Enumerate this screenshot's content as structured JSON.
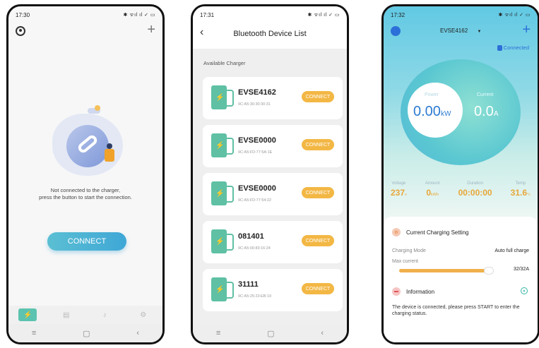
{
  "phone1": {
    "status_time": "17:30",
    "status_icons": "✱ ᯤıl ıl ✓ ▭",
    "message_line1": "Not connected to the charger,",
    "message_line2": "press the button to start the connection.",
    "connect_label": "CONNECT",
    "tabs": [
      {
        "icon": "lightning-icon",
        "glyph": "⚡"
      },
      {
        "icon": "document-icon",
        "glyph": "▤"
      },
      {
        "icon": "bell-icon",
        "glyph": "♪"
      },
      {
        "icon": "settings-icon",
        "glyph": "⚙"
      }
    ],
    "nav": [
      "≡",
      "▢",
      "‹"
    ]
  },
  "phone2": {
    "status_time": "17:31",
    "status_icons": "✱ ᯤıl ıl ✓ ▭",
    "back": "‹",
    "title": "Bluetooth Device List",
    "section_label": "Available Charger",
    "devices": [
      {
        "name": "EVSE4162",
        "mac": "9C:A5:30:30:30:31",
        "button": "CONNECT"
      },
      {
        "name": "EVSE0000",
        "mac": "9C:A5:FD:77:5A:1E",
        "button": "CONNECT"
      },
      {
        "name": "EVSE0000",
        "mac": "9C:A5:FD:77:54:22",
        "button": "CONNECT"
      },
      {
        "name": "081401",
        "mac": "9C:A5:00:83:16:24",
        "button": "CONNECT"
      },
      {
        "name": "31111",
        "mac": "9C:A5:25:23:EB:19",
        "button": "CONNECT"
      }
    ],
    "nav": [
      "≡",
      "▢",
      "‹"
    ]
  },
  "phone3": {
    "status_time": "17:32",
    "status_icons": "✱ ᯤıl ıl ✓ ▭",
    "device_name": "EVSE4162",
    "dropdown": "▼",
    "connected_label": "Connected",
    "power_label": "Power",
    "power_value": "0.00",
    "power_unit": "kW",
    "current_label": "Current",
    "current_value": "0.0",
    "current_unit": "A",
    "stats": [
      {
        "label": "Voltage",
        "value": "237",
        "unit": "v"
      },
      {
        "label": "Amount",
        "value": "0",
        "unit": "kWh"
      },
      {
        "label": "Duration",
        "value": "00:00:00",
        "unit": ""
      },
      {
        "label": "Temp",
        "value": "31.6",
        "unit": "°c"
      }
    ],
    "setting_title": "Current Charging Setting",
    "mode_label": "Charging Mode",
    "mode_value": "Auto full charge",
    "max_current_label": "Max current",
    "slider_value": "32/32A",
    "slider_fraction": 1.0,
    "info_title": "Information",
    "info_text": "The device is connected, please press START to enter the charging status.",
    "colors": {
      "accent": "#2d7bd0",
      "amount": "#e8a73a",
      "teal": "#5fc0a4"
    }
  }
}
